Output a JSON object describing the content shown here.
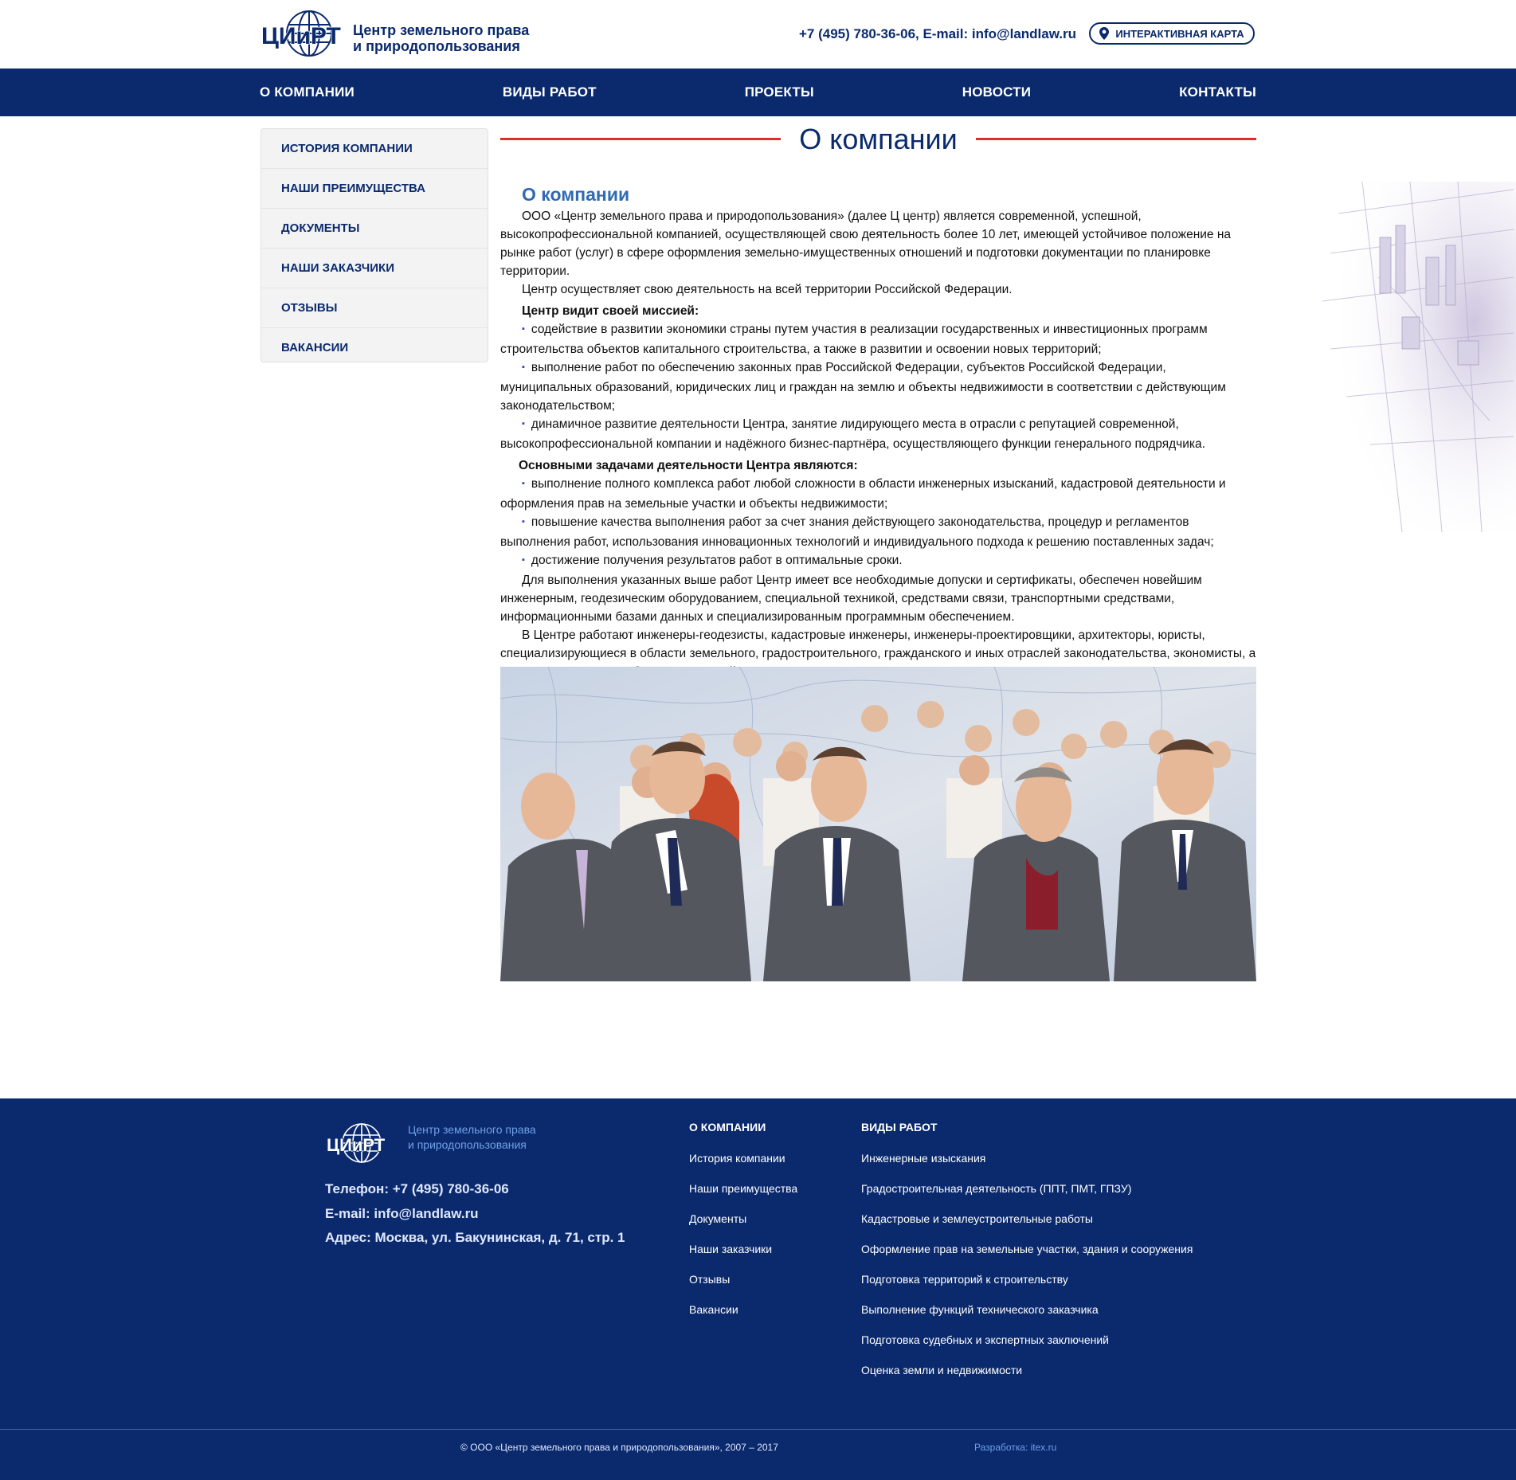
{
  "header": {
    "logo_text": "ЦИиРТ",
    "company_line1": "Центр земельного права",
    "company_line2": "и природопользования",
    "contacts": "+7 (495) 780-36-06,  E-mail: info@landlaw.ru",
    "map_button": "Интерактивная карта"
  },
  "nav": {
    "items": [
      "О компании",
      "Виды работ",
      "Проекты",
      "Новости",
      "Контакты"
    ]
  },
  "sidebar": {
    "items": [
      "История компании",
      "Наши преимущества",
      "Документы",
      "Наши заказчики",
      "Отзывы",
      "Вакансии"
    ]
  },
  "main": {
    "page_title": "О компании",
    "section_title": "О компании",
    "intro1": "ООО «Центр земельного права и природопользования» (далее Ц центр) является современной, успешной, высокопрофессиональной компанией, осуществляющей свою деятельность более 10 лет, имеющей устойчивое положение на рынке работ (услуг) в сфере оформления земельно-имущественных отношений и подготовки документации по планировке территории.",
    "intro2": "Центр осуществляет свою деятельность на всей территории Российской Федерации.",
    "mission_title": "Центр видит своей миссией:",
    "mission": [
      "содействие в развитии экономики страны путем участия в реализации государственных и инвестиционных программ строительства объектов капитального строительства, а также в развитии и освоении новых территорий;",
      "выполнение работ по обеспечению законных прав Российской Федерации, субъектов Российской Федерации, муниципальных образований, юридических лиц и граждан на землю и объекты недвижимости в соответствии с действующим законодательством;",
      "динамичное развитие деятельности Центра, занятие лидирующего места в отрасли с репутацией современной, высокопрофессиональной компании и надёжного бизнес-партнёра, осуществляющего функции генерального подрядчика."
    ],
    "tasks_title": "Основными задачами деятельности Центра являются:",
    "tasks": [
      "выполнение полного комплекса работ любой сложности в области инженерных изысканий, кадастровой деятельности и оформления прав на земельные участки и объекты недвижимости;",
      "повышение качества выполнения работ за счет знания действующего законодательства, процедур и регламентов выполнения работ, использования инновационных технологий и индивидуального подхода к решению поставленных задач;",
      "достижение получения результатов работ в оптимальные сроки."
    ],
    "para3": "Для выполнения указанных выше работ Центр имеет все необходимые допуски и сертификаты, обеспечен новейшим инженерным, геодезическим оборудованием, специальной техникой, средствами связи, транспортными средствами, информационными базами данных и специализированным программным обеспечением.",
    "para4": "В Центре работают инженеры-геодезисты, кадастровые инженеры, инженеры-проектировщики, архитекторы, юристы, специализирующиеся в области земельного, градостроительного, гражданского и иных отраслей законодательства, экономисты, а также специалисты в области оценочной деятельности и иные специалисты."
  },
  "footer": {
    "logo_text": "ЦИиРТ",
    "company_line1": "Центр земельного права",
    "company_line2": "и природопользования",
    "phone": "Телефон: +7 (495) 780-36-06",
    "email": "E-mail: info@landlaw.ru",
    "address": "Адрес: Москва, ул. Бакунинская, д. 71, стр. 1",
    "col1_title": "О компании",
    "col1_links": [
      "История компании",
      "Наши преимущества",
      "Документы",
      "Наши заказчики",
      "Отзывы",
      "Вакансии"
    ],
    "col2_title": "Виды работ",
    "col2_links": [
      "Инженерные изыскания",
      "Градостроительная деятельность (ППТ, ПМТ, ГПЗУ)",
      "Кадастровые и землеустроительные работы",
      "Оформление прав на земельные участки, здания и сооружения",
      "Подготовка территорий к строительству",
      "Выполнение функций технического заказчика",
      "Подготовка судебных и экспертных заключений",
      "Оценка земли и недвижимости"
    ],
    "copyright": "© ООО «Центр земельного права и природопользования», 2007 – 2017",
    "developer": "Разработка: itex.ru"
  },
  "colors": {
    "brand": "#0b2a6d",
    "accent_red": "#d9302a",
    "heading_blue": "#2f6ab3"
  },
  "icons": [
    "globe-logo-icon",
    "map-pin-icon",
    "bullet-icon"
  ]
}
